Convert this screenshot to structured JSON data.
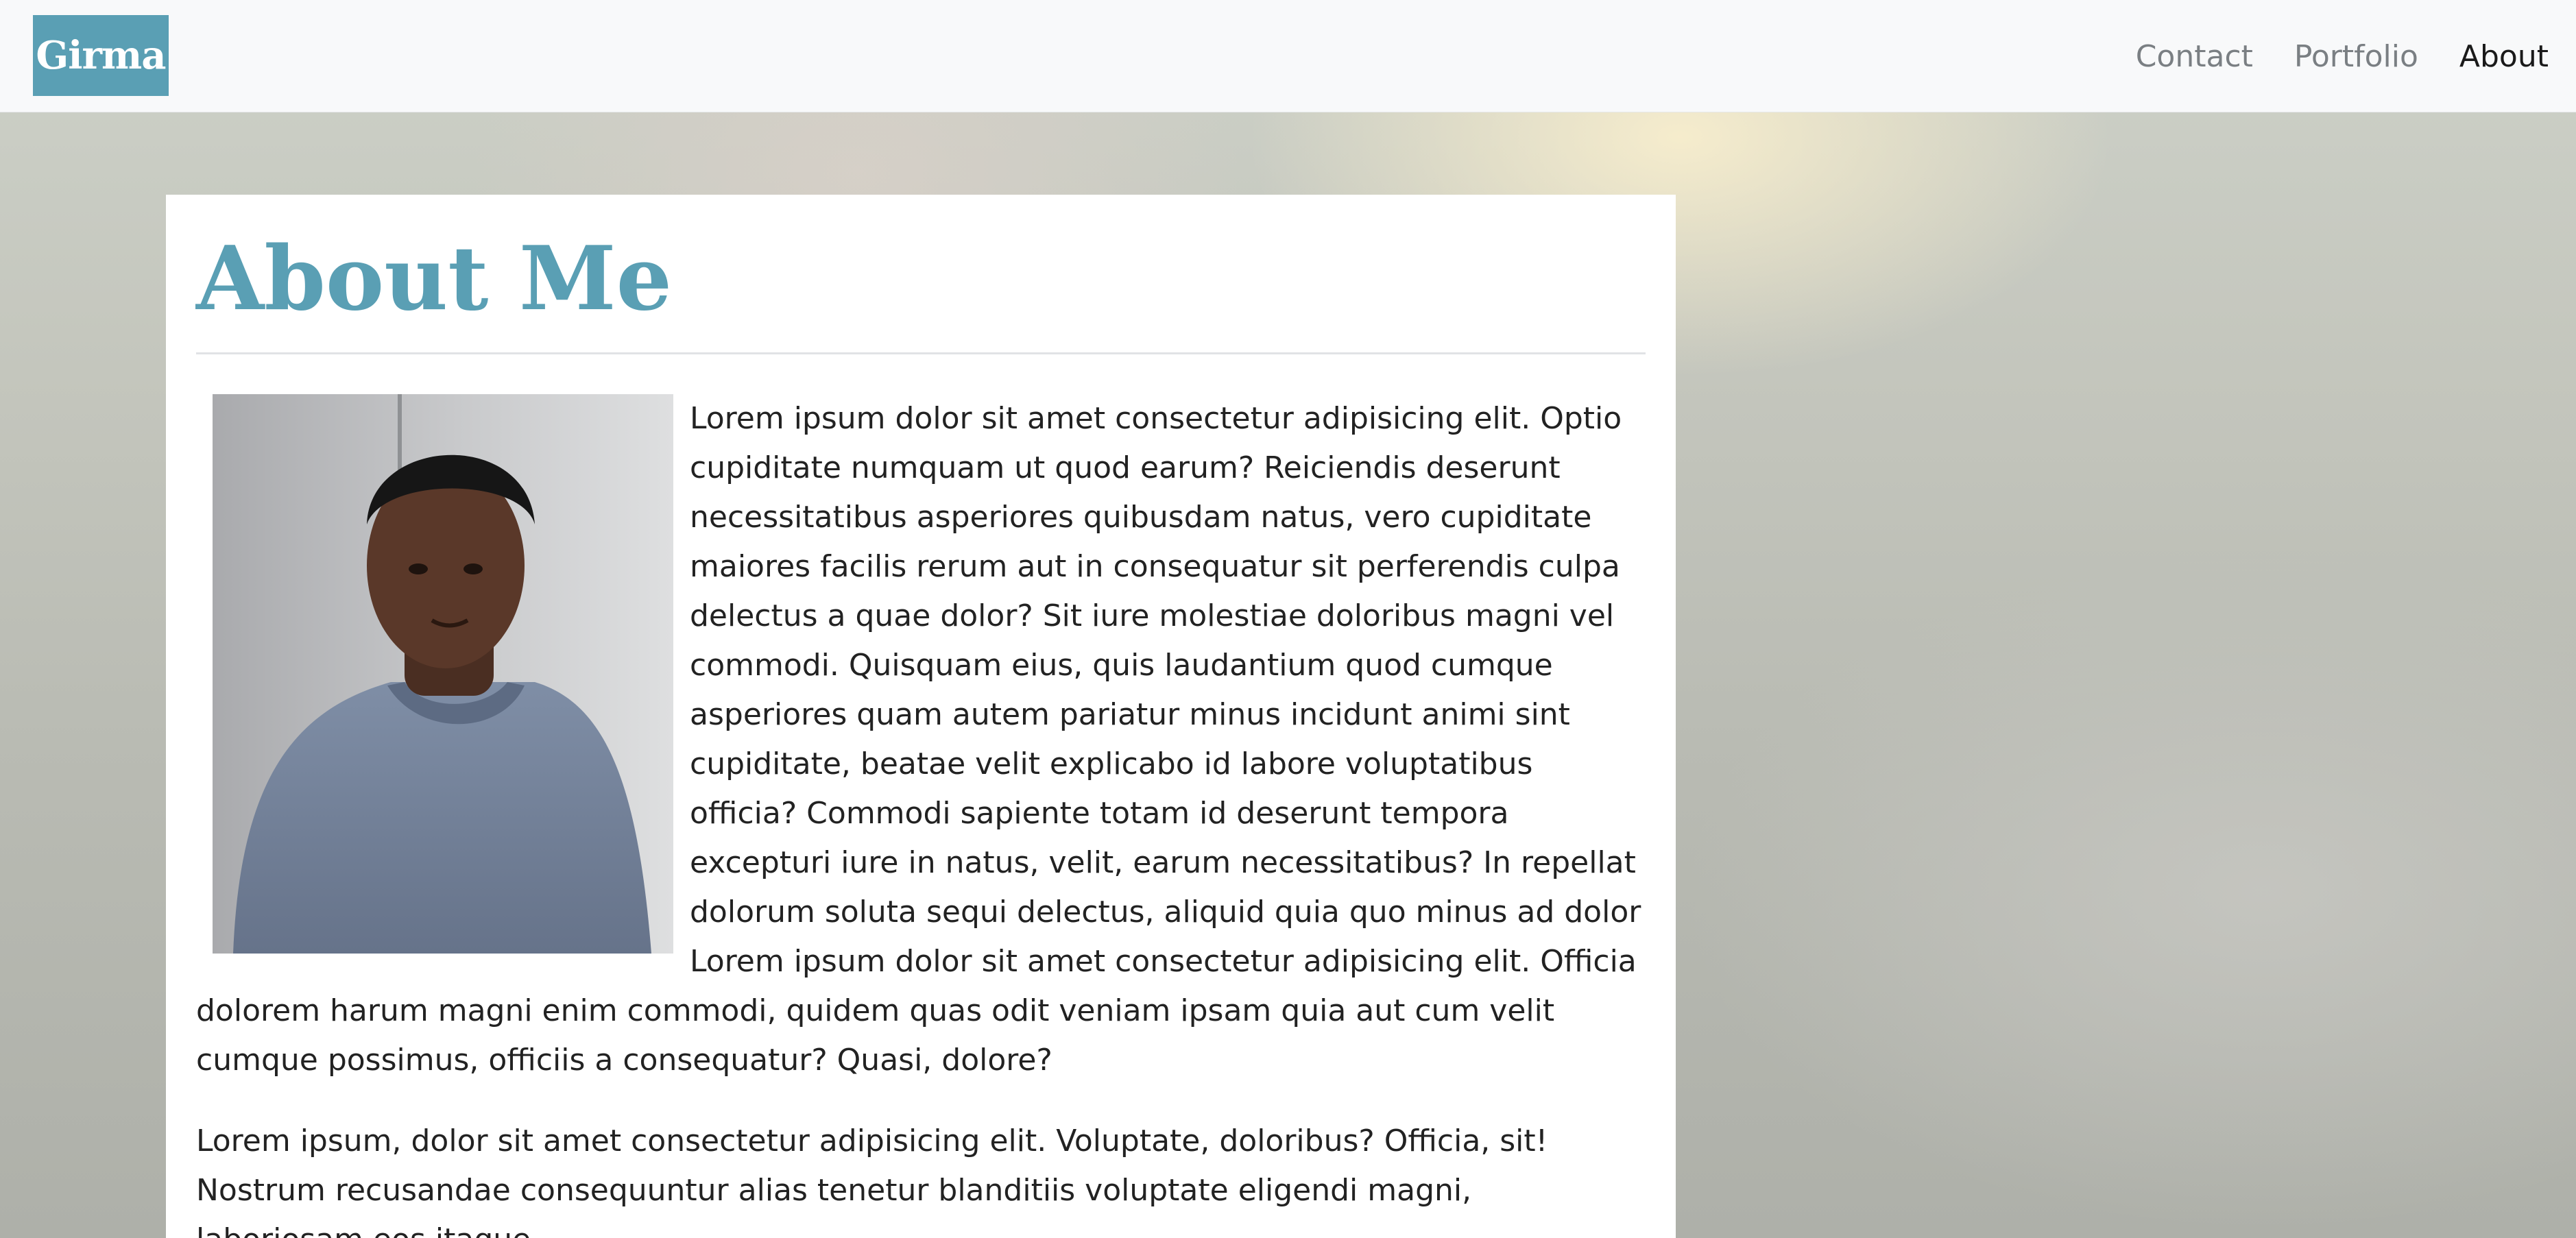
{
  "navbar": {
    "brand": "Girma",
    "links": [
      {
        "label": "Contact"
      },
      {
        "label": "Portfolio"
      },
      {
        "label": "About",
        "active": true
      }
    ]
  },
  "main": {
    "title": "About Me",
    "photo_icon": "portrait-photo",
    "paragraphs": [
      "Lorem ipsum dolor sit amet consectetur adipisicing elit. Optio cupiditate numquam ut quod earum? Reiciendis deserunt necessitatibus asperiores quibusdam natus, vero cupiditate maiores facilis rerum aut in consequatur sit perferendis culpa delectus a quae dolor? Sit iure molestiae doloribus magni vel commodi. Quisquam eius, quis laudantium quod cumque asperiores quam autem pariatur minus incidunt animi sint cupiditate, beatae velit explicabo id labore voluptatibus officia? Commodi sapiente totam id deserunt tempora excepturi iure in natus, velit, earum necessitatibus? In repellat dolorum soluta sequi delectus, aliquid quia quo minus ad dolor Lorem ipsum dolor sit amet consectetur adipisicing elit. Officia dolorem harum magni enim commodi, quidem quas odit veniam ipsam quia aut cum velit cumque possimus, officiis a consequatur? Quasi, dolore?",
      "Lorem ipsum, dolor sit amet consectetur adipisicing elit. Voluptate, doloribus? Officia, sit! Nostrum recusandae consequuntur alias tenetur blanditiis voluptate eligendi magni, laboriosam eos itaque"
    ]
  },
  "colors": {
    "accent": "#5a9fb4",
    "navbar_bg": "#f8f9fa",
    "nav_link": "#7a7f83",
    "nav_link_active": "#1a1a1a",
    "text": "#222222"
  }
}
